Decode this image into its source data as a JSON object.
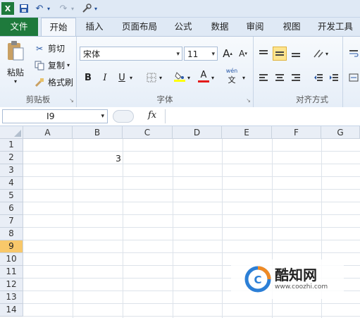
{
  "qat": {
    "undo": "↶",
    "redo": "↷"
  },
  "tabs": [
    "文件",
    "开始",
    "插入",
    "页面布局",
    "公式",
    "数据",
    "审阅",
    "视图",
    "开发工具"
  ],
  "clipboard": {
    "paste": "粘贴",
    "cut": "剪切",
    "copy": "复制",
    "format_painter": "格式刷",
    "group_label": "剪贴板"
  },
  "font": {
    "name": "宋体",
    "size": "11",
    "grow": "A",
    "shrink": "A",
    "bold": "B",
    "italic": "I",
    "underline": "U",
    "font_color": "A",
    "phonetic": "wén",
    "group_label": "字体"
  },
  "alignment": {
    "group_label": "对齐方式"
  },
  "formula_bar": {
    "cell_ref": "I9",
    "fx": "fx"
  },
  "columns": [
    "A",
    "B",
    "C",
    "D",
    "E",
    "F",
    "G"
  ],
  "rows": [
    "1",
    "2",
    "3",
    "4",
    "5",
    "6",
    "7",
    "8",
    "9",
    "10",
    "11",
    "12",
    "13",
    "14"
  ],
  "cells": {
    "B2": "3"
  },
  "active_row": "9",
  "watermark": {
    "brand": "酷知网",
    "url": "www.coozhi.com"
  },
  "colors": {
    "file_tab": "#1e7a3c",
    "active_row_header": "#f8c86a",
    "highlight": "#fde48e"
  }
}
